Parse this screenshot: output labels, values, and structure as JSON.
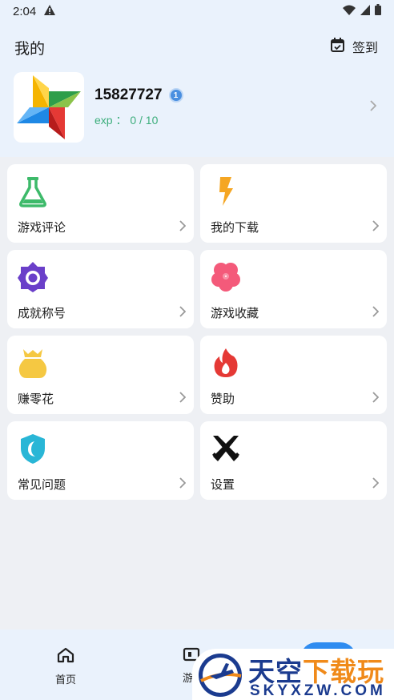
{
  "status_bar": {
    "time": "2:04"
  },
  "header": {
    "title": "我的",
    "checkin_label": "签到",
    "username": "15827727",
    "level": "1",
    "exp_text": "exp ： 0 / 10"
  },
  "menu": [
    {
      "label": "游戏评论",
      "icon": "flask-icon",
      "color": "#3dba6a"
    },
    {
      "label": "我的下载",
      "icon": "lightning-icon",
      "color": "#f5a623"
    },
    {
      "label": "成就称号",
      "icon": "badge-icon",
      "color": "#6a3fc9"
    },
    {
      "label": "游戏收藏",
      "icon": "clover-icon",
      "color": "#f45a7a"
    },
    {
      "label": "赚零花",
      "icon": "money-bag-icon",
      "color": "#f5c842"
    },
    {
      "label": "赞助",
      "icon": "flame-icon",
      "color": "#e53935"
    },
    {
      "label": "常见问题",
      "icon": "shield-moon-icon",
      "color": "#29b6d6"
    },
    {
      "label": "设置",
      "icon": "crossed-swords-icon",
      "color": "#111111"
    }
  ],
  "bottom_nav": {
    "home_label": "首页",
    "game_label": "游"
  },
  "watermark": {
    "cn_part1": "天空",
    "cn_part2": "下载玩",
    "en": "SKYXZW.COM"
  }
}
